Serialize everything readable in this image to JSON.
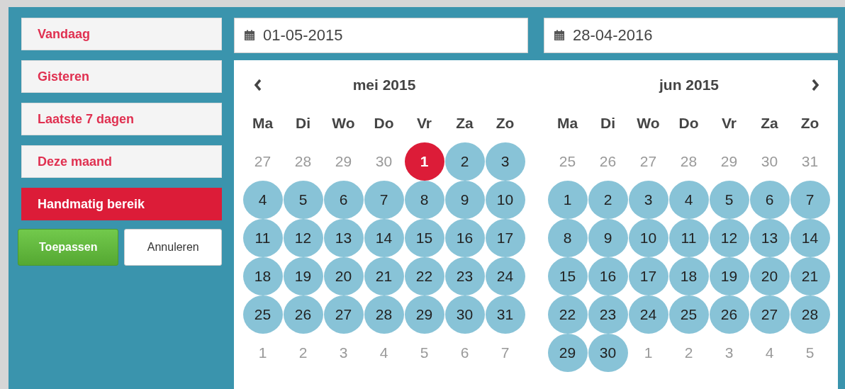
{
  "ranges": [
    {
      "label": "Vandaag",
      "selected": false
    },
    {
      "label": "Gisteren",
      "selected": false
    },
    {
      "label": "Laatste 7 dagen",
      "selected": false
    },
    {
      "label": "Deze maand",
      "selected": false
    },
    {
      "label": "Handmatig bereik",
      "selected": true
    }
  ],
  "apply_button": "Toepassen",
  "cancel_button": "Annuleren",
  "start_field": {
    "value": "01-05-2015"
  },
  "end_field": {
    "value": "28-04-2016"
  },
  "months": [
    {
      "title": "mei 2015",
      "prev_button": true,
      "next_button": false,
      "weekdays": [
        "Ma",
        "Di",
        "Wo",
        "Do",
        "Vr",
        "Za",
        "Zo"
      ],
      "weeks": [
        [
          {
            "day": "27",
            "kind": "off"
          },
          {
            "day": "28",
            "kind": "off"
          },
          {
            "day": "29",
            "kind": "off"
          },
          {
            "day": "30",
            "kind": "off"
          },
          {
            "day": "1",
            "kind": "start"
          },
          {
            "day": "2",
            "kind": "range"
          },
          {
            "day": "3",
            "kind": "range"
          }
        ],
        [
          {
            "day": "4",
            "kind": "range"
          },
          {
            "day": "5",
            "kind": "range"
          },
          {
            "day": "6",
            "kind": "range"
          },
          {
            "day": "7",
            "kind": "range"
          },
          {
            "day": "8",
            "kind": "range"
          },
          {
            "day": "9",
            "kind": "range"
          },
          {
            "day": "10",
            "kind": "range"
          }
        ],
        [
          {
            "day": "11",
            "kind": "range"
          },
          {
            "day": "12",
            "kind": "range"
          },
          {
            "day": "13",
            "kind": "range"
          },
          {
            "day": "14",
            "kind": "range"
          },
          {
            "day": "15",
            "kind": "range"
          },
          {
            "day": "16",
            "kind": "range"
          },
          {
            "day": "17",
            "kind": "range"
          }
        ],
        [
          {
            "day": "18",
            "kind": "range"
          },
          {
            "day": "19",
            "kind": "range"
          },
          {
            "day": "20",
            "kind": "range"
          },
          {
            "day": "21",
            "kind": "range"
          },
          {
            "day": "22",
            "kind": "range"
          },
          {
            "day": "23",
            "kind": "range"
          },
          {
            "day": "24",
            "kind": "range"
          }
        ],
        [
          {
            "day": "25",
            "kind": "range"
          },
          {
            "day": "26",
            "kind": "range"
          },
          {
            "day": "27",
            "kind": "range"
          },
          {
            "day": "28",
            "kind": "range"
          },
          {
            "day": "29",
            "kind": "range"
          },
          {
            "day": "30",
            "kind": "range"
          },
          {
            "day": "31",
            "kind": "range"
          }
        ],
        [
          {
            "day": "1",
            "kind": "off"
          },
          {
            "day": "2",
            "kind": "off"
          },
          {
            "day": "3",
            "kind": "off"
          },
          {
            "day": "4",
            "kind": "off"
          },
          {
            "day": "5",
            "kind": "off"
          },
          {
            "day": "6",
            "kind": "off"
          },
          {
            "day": "7",
            "kind": "off"
          }
        ]
      ]
    },
    {
      "title": "jun 2015",
      "prev_button": false,
      "next_button": true,
      "weekdays": [
        "Ma",
        "Di",
        "Wo",
        "Do",
        "Vr",
        "Za",
        "Zo"
      ],
      "weeks": [
        [
          {
            "day": "25",
            "kind": "off"
          },
          {
            "day": "26",
            "kind": "off"
          },
          {
            "day": "27",
            "kind": "off"
          },
          {
            "day": "28",
            "kind": "off"
          },
          {
            "day": "29",
            "kind": "off"
          },
          {
            "day": "30",
            "kind": "off"
          },
          {
            "day": "31",
            "kind": "off"
          }
        ],
        [
          {
            "day": "1",
            "kind": "range"
          },
          {
            "day": "2",
            "kind": "range"
          },
          {
            "day": "3",
            "kind": "range"
          },
          {
            "day": "4",
            "kind": "range"
          },
          {
            "day": "5",
            "kind": "range"
          },
          {
            "day": "6",
            "kind": "range"
          },
          {
            "day": "7",
            "kind": "range"
          }
        ],
        [
          {
            "day": "8",
            "kind": "range"
          },
          {
            "day": "9",
            "kind": "range"
          },
          {
            "day": "10",
            "kind": "range"
          },
          {
            "day": "11",
            "kind": "range"
          },
          {
            "day": "12",
            "kind": "range"
          },
          {
            "day": "13",
            "kind": "range"
          },
          {
            "day": "14",
            "kind": "range"
          }
        ],
        [
          {
            "day": "15",
            "kind": "range"
          },
          {
            "day": "16",
            "kind": "range"
          },
          {
            "day": "17",
            "kind": "range"
          },
          {
            "day": "18",
            "kind": "range"
          },
          {
            "day": "19",
            "kind": "range"
          },
          {
            "day": "20",
            "kind": "range"
          },
          {
            "day": "21",
            "kind": "range"
          }
        ],
        [
          {
            "day": "22",
            "kind": "range"
          },
          {
            "day": "23",
            "kind": "range"
          },
          {
            "day": "24",
            "kind": "range"
          },
          {
            "day": "25",
            "kind": "range"
          },
          {
            "day": "26",
            "kind": "range"
          },
          {
            "day": "27",
            "kind": "range"
          },
          {
            "day": "28",
            "kind": "range"
          }
        ],
        [
          {
            "day": "29",
            "kind": "range"
          },
          {
            "day": "30",
            "kind": "range"
          },
          {
            "day": "1",
            "kind": "off"
          },
          {
            "day": "2",
            "kind": "off"
          },
          {
            "day": "3",
            "kind": "off"
          },
          {
            "day": "4",
            "kind": "off"
          },
          {
            "day": "5",
            "kind": "off"
          }
        ]
      ]
    }
  ]
}
